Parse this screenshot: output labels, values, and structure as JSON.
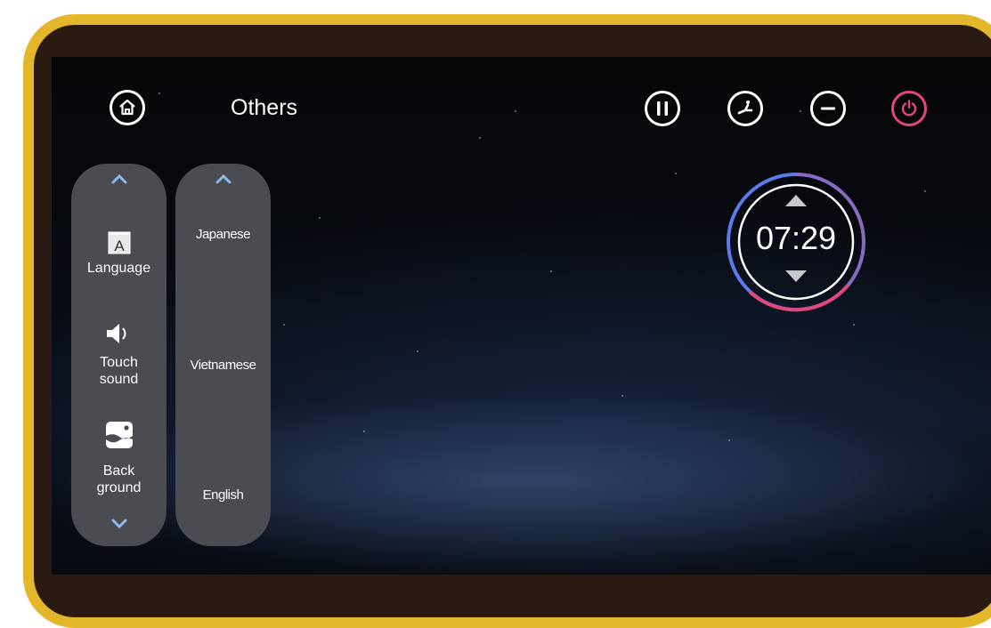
{
  "header": {
    "title": "Others",
    "icons": {
      "home": "home-icon",
      "pause": "pause-icon",
      "recline": "recline-icon",
      "minus": "minus-icon",
      "power": "power-icon"
    },
    "power_color": "#e0477a"
  },
  "menu": {
    "items": [
      {
        "label": "Language",
        "icon": "language-icon"
      },
      {
        "label": "Touch\nsound",
        "icon": "speaker-icon"
      },
      {
        "label": "Back\nground",
        "icon": "background-icon"
      }
    ]
  },
  "languages": {
    "options": [
      "Japanese",
      "Vietnamese",
      "English"
    ]
  },
  "timer": {
    "value": "07:29",
    "ring_colors": [
      "#5b7be8",
      "#e0477a"
    ]
  }
}
